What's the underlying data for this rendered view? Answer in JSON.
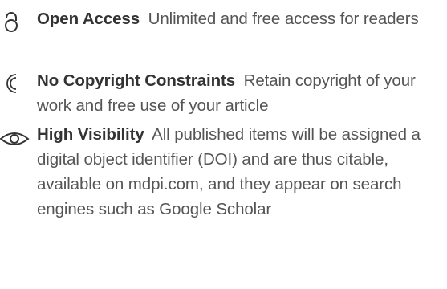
{
  "features": [
    {
      "icon": "open-lock-icon",
      "title": "Open Access",
      "description": "Unlimited and free access for readers"
    },
    {
      "icon": "copyright-icon",
      "title": "No Copyright Constraints",
      "description": "Retain copyright of your work and free use of your article"
    },
    {
      "icon": "eye-icon",
      "title": "High Visibility",
      "description": "All published items will be assigned a digital object identifier (DOI) and are thus citable, available on mdpi.com, and they appear on search engines such as Google Scholar"
    }
  ],
  "colors": {
    "icon": "#333333",
    "title": "#333333",
    "text": "#555555"
  }
}
